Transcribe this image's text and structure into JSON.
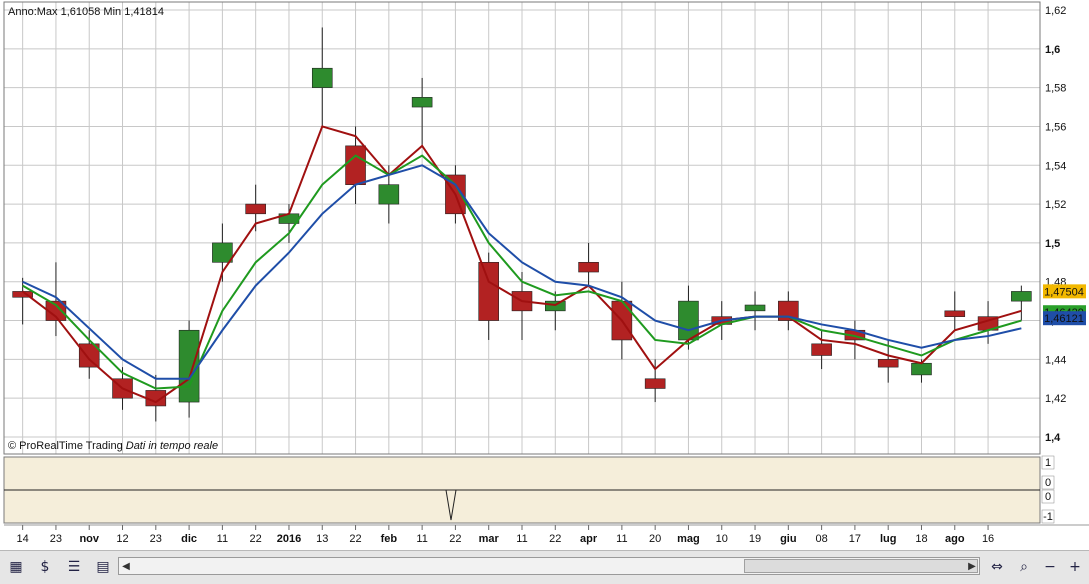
{
  "header": {
    "label": "Anno:",
    "max_label": "Max",
    "max_value": "1,61058",
    "min_label": "Min",
    "min_value": "1,41814"
  },
  "credit": {
    "brand": "© ProRealTime Trading",
    "note": "Dati in tempo reale"
  },
  "price_axis": {
    "ticks": [
      "1,62",
      "1,6",
      "1,58",
      "1,56",
      "1,54",
      "1,52",
      "1,5",
      "1,48",
      "1,46",
      "1,44",
      "1,42",
      "1,4"
    ],
    "bold_ticks": [
      "1,6",
      "1,5",
      "1,4"
    ]
  },
  "price_tags": [
    {
      "value": "1,47504",
      "color": "#f2b800"
    },
    {
      "value": "1,46429",
      "color": "#2aa02a"
    },
    {
      "value": "1,46121",
      "color": "#1f4ea8"
    }
  ],
  "indicator_axis": {
    "ticks": [
      "1",
      "0",
      "0",
      "-1"
    ]
  },
  "date_axis": [
    {
      "label": "14",
      "bold": false
    },
    {
      "label": "23",
      "bold": false
    },
    {
      "label": "nov",
      "bold": true
    },
    {
      "label": "12",
      "bold": false
    },
    {
      "label": "23",
      "bold": false
    },
    {
      "label": "dic",
      "bold": true
    },
    {
      "label": "11",
      "bold": false
    },
    {
      "label": "22",
      "bold": false
    },
    {
      "label": "2016",
      "bold": true
    },
    {
      "label": "13",
      "bold": false
    },
    {
      "label": "22",
      "bold": false
    },
    {
      "label": "feb",
      "bold": true
    },
    {
      "label": "11",
      "bold": false
    },
    {
      "label": "22",
      "bold": false
    },
    {
      "label": "mar",
      "bold": true
    },
    {
      "label": "11",
      "bold": false
    },
    {
      "label": "22",
      "bold": false
    },
    {
      "label": "apr",
      "bold": true
    },
    {
      "label": "11",
      "bold": false
    },
    {
      "label": "20",
      "bold": false
    },
    {
      "label": "mag",
      "bold": true
    },
    {
      "label": "10",
      "bold": false
    },
    {
      "label": "19",
      "bold": false
    },
    {
      "label": "giu",
      "bold": true
    },
    {
      "label": "08",
      "bold": false
    },
    {
      "label": "17",
      "bold": false
    },
    {
      "label": "lug",
      "bold": true
    },
    {
      "label": "18",
      "bold": false
    },
    {
      "label": "ago",
      "bold": true
    },
    {
      "label": "16",
      "bold": false
    }
  ],
  "colors": {
    "up": "#2e8b2e",
    "down": "#b22222",
    "ma_red": "#a01010",
    "ma_green": "#1f9a1f",
    "ma_blue": "#1f4ea8",
    "grid": "#c8c8c8",
    "indicator_bg": "#f5eeda"
  },
  "toolbar": {
    "icons": [
      "chart-type-icon",
      "indicators-icon",
      "properties-icon",
      "drawing-tools-icon"
    ],
    "zoom_icons": [
      "zoom-fit-icon",
      "zoom-out-icon",
      "zoom-in-icon"
    ]
  },
  "chart_data": {
    "type": "candlestick",
    "period": "Anno",
    "max": 1.61058,
    "min": 1.41814,
    "ylim": [
      1.4,
      1.62
    ],
    "grid": true,
    "last_price": 1.47504,
    "candles": [
      {
        "date": "14",
        "open": 1.475,
        "high": 1.482,
        "low": 1.458,
        "close": 1.472
      },
      {
        "date": "23",
        "open": 1.47,
        "high": 1.49,
        "low": 1.452,
        "close": 1.46
      },
      {
        "date": "nov",
        "open": 1.448,
        "high": 1.455,
        "low": 1.43,
        "close": 1.436
      },
      {
        "date": "12",
        "open": 1.43,
        "high": 1.436,
        "low": 1.414,
        "close": 1.42
      },
      {
        "date": "23",
        "open": 1.424,
        "high": 1.432,
        "low": 1.408,
        "close": 1.416
      },
      {
        "date": "dic",
        "open": 1.418,
        "high": 1.46,
        "low": 1.41,
        "close": 1.455
      },
      {
        "date": "11",
        "open": 1.49,
        "high": 1.51,
        "low": 1.48,
        "close": 1.5
      },
      {
        "date": "22",
        "open": 1.52,
        "high": 1.53,
        "low": 1.506,
        "close": 1.515
      },
      {
        "date": "2016",
        "open": 1.51,
        "high": 1.52,
        "low": 1.5,
        "close": 1.515
      },
      {
        "date": "13",
        "open": 1.58,
        "high": 1.611,
        "low": 1.56,
        "close": 1.59
      },
      {
        "date": "22",
        "open": 1.55,
        "high": 1.56,
        "low": 1.52,
        "close": 1.53
      },
      {
        "date": "feb",
        "open": 1.52,
        "high": 1.54,
        "low": 1.51,
        "close": 1.53
      },
      {
        "date": "11",
        "open": 1.57,
        "high": 1.585,
        "low": 1.55,
        "close": 1.575
      },
      {
        "date": "22",
        "open": 1.535,
        "high": 1.54,
        "low": 1.51,
        "close": 1.515
      },
      {
        "date": "mar",
        "open": 1.49,
        "high": 1.495,
        "low": 1.45,
        "close": 1.46
      },
      {
        "date": "11",
        "open": 1.475,
        "high": 1.485,
        "low": 1.45,
        "close": 1.465
      },
      {
        "date": "22",
        "open": 1.465,
        "high": 1.475,
        "low": 1.455,
        "close": 1.47
      },
      {
        "date": "apr",
        "open": 1.49,
        "high": 1.5,
        "low": 1.478,
        "close": 1.485
      },
      {
        "date": "11",
        "open": 1.47,
        "high": 1.48,
        "low": 1.44,
        "close": 1.45
      },
      {
        "date": "20",
        "open": 1.43,
        "high": 1.44,
        "low": 1.418,
        "close": 1.425
      },
      {
        "date": "mag",
        "open": 1.45,
        "high": 1.478,
        "low": 1.445,
        "close": 1.47
      },
      {
        "date": "10",
        "open": 1.462,
        "high": 1.47,
        "low": 1.45,
        "close": 1.458
      },
      {
        "date": "19",
        "open": 1.465,
        "high": 1.475,
        "low": 1.455,
        "close": 1.468
      },
      {
        "date": "giu",
        "open": 1.47,
        "high": 1.475,
        "low": 1.455,
        "close": 1.46
      },
      {
        "date": "08",
        "open": 1.448,
        "high": 1.455,
        "low": 1.435,
        "close": 1.442
      },
      {
        "date": "17",
        "open": 1.455,
        "high": 1.46,
        "low": 1.44,
        "close": 1.45
      },
      {
        "date": "lug",
        "open": 1.44,
        "high": 1.45,
        "low": 1.428,
        "close": 1.436
      },
      {
        "date": "18",
        "open": 1.432,
        "high": 1.44,
        "low": 1.428,
        "close": 1.438
      },
      {
        "date": "ago",
        "open": 1.465,
        "high": 1.475,
        "low": 1.455,
        "close": 1.462
      },
      {
        "date": "16",
        "open": 1.462,
        "high": 1.47,
        "low": 1.448,
        "close": 1.455
      },
      {
        "date": "",
        "open": 1.47,
        "high": 1.478,
        "low": 1.46,
        "close": 1.475
      }
    ],
    "moving_averages": [
      {
        "color": "#a01010",
        "values": [
          1.475,
          1.462,
          1.44,
          1.425,
          1.418,
          1.43,
          1.485,
          1.51,
          1.515,
          1.56,
          1.555,
          1.535,
          1.55,
          1.525,
          1.48,
          1.47,
          1.468,
          1.478,
          1.46,
          1.435,
          1.45,
          1.46,
          1.462,
          1.462,
          1.45,
          1.448,
          1.442,
          1.438,
          1.455,
          1.46,
          1.465
        ]
      },
      {
        "color": "#1f9a1f",
        "values": [
          1.478,
          1.468,
          1.45,
          1.433,
          1.425,
          1.426,
          1.465,
          1.49,
          1.505,
          1.53,
          1.545,
          1.535,
          1.545,
          1.53,
          1.5,
          1.48,
          1.473,
          1.475,
          1.47,
          1.45,
          1.448,
          1.458,
          1.462,
          1.462,
          1.455,
          1.452,
          1.447,
          1.442,
          1.45,
          1.455,
          1.46
        ]
      },
      {
        "color": "#1f4ea8",
        "values": [
          1.48,
          1.472,
          1.456,
          1.44,
          1.43,
          1.43,
          1.455,
          1.478,
          1.495,
          1.515,
          1.53,
          1.535,
          1.54,
          1.53,
          1.505,
          1.49,
          1.48,
          1.478,
          1.472,
          1.46,
          1.455,
          1.46,
          1.462,
          1.462,
          1.458,
          1.455,
          1.45,
          1.446,
          1.45,
          1.452,
          1.456
        ]
      }
    ]
  }
}
